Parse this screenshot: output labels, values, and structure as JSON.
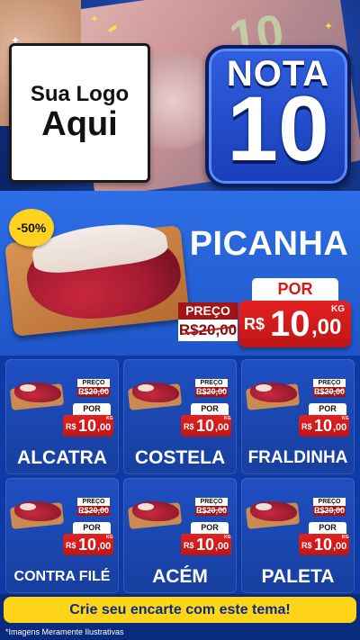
{
  "header": {
    "logo_line1": "Sua Logo",
    "logo_line2": "Aqui",
    "badge_word": "NOTA",
    "badge_number": "10",
    "banknote_number": "10"
  },
  "hero": {
    "discount": "-50%",
    "name": "PICANHA",
    "preco_label": "PREÇO",
    "old_price": "R$20,00",
    "por_label": "POR",
    "currency": "R$",
    "price_int": "10",
    "price_dec": ",00",
    "unit": "KG"
  },
  "products": [
    {
      "name": "ALCATRA",
      "preco_label": "PREÇO",
      "old_price": "R$20,00",
      "por_label": "POR",
      "currency": "R$",
      "price_int": "10",
      "price_dec": ",00",
      "unit": "KG"
    },
    {
      "name": "COSTELA",
      "preco_label": "PREÇO",
      "old_price": "R$20,00",
      "por_label": "POR",
      "currency": "R$",
      "price_int": "10",
      "price_dec": ",00",
      "unit": "KG"
    },
    {
      "name": "FRALDINHA",
      "preco_label": "PREÇO",
      "old_price": "R$20,00",
      "por_label": "POR",
      "currency": "R$",
      "price_int": "10",
      "price_dec": ",00",
      "unit": "KG"
    },
    {
      "name": "CONTRA FILÉ",
      "preco_label": "PREÇO",
      "old_price": "R$20,00",
      "por_label": "POR",
      "currency": "R$",
      "price_int": "10",
      "price_dec": ",00",
      "unit": "KG"
    },
    {
      "name": "ACÉM",
      "preco_label": "PREÇO",
      "old_price": "R$20,00",
      "por_label": "POR",
      "currency": "R$",
      "price_int": "10",
      "price_dec": ",00",
      "unit": "KG"
    },
    {
      "name": "PALETA",
      "preco_label": "PREÇO",
      "old_price": "R$20,00",
      "por_label": "POR",
      "currency": "R$",
      "price_int": "10",
      "price_dec": ",00",
      "unit": "KG"
    }
  ],
  "footer": {
    "cta": "Crie seu encarte com este tema!",
    "disclaimer": "*Imagens Meramente Ilustrativas"
  },
  "colors": {
    "brand_blue": "#1f56c9",
    "price_red": "#d31a1a",
    "cta_yellow": "#ffd51a"
  }
}
